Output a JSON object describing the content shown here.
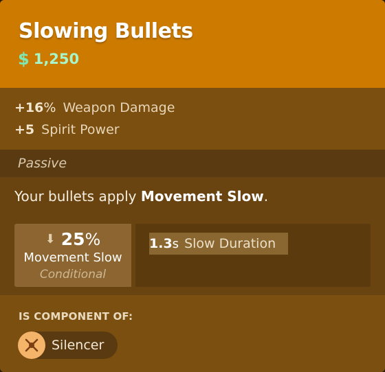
{
  "item": {
    "title": "Slowing Bullets",
    "cost": "1,250",
    "cost_icon": "souls-icon"
  },
  "stats": [
    {
      "value": "+16",
      "unit": "%",
      "label": "Weapon Damage"
    },
    {
      "value": "+5",
      "unit": "",
      "label": "Spirit Power"
    }
  ],
  "passive": {
    "header": "Passive",
    "description_prefix": "Your bullets apply ",
    "description_bold": "Movement Slow",
    "description_suffix": ".",
    "primary": {
      "value": "25",
      "unit": "%",
      "label": "Movement Slow",
      "condition": "Conditional",
      "icon": "slow-boot-icon"
    },
    "secondary": {
      "value": "1.3",
      "unit": "s",
      "label": "Slow Duration"
    }
  },
  "components": {
    "title": "IS COMPONENT OF:",
    "items": [
      {
        "name": "Silencer",
        "icon": "silencer-icon"
      }
    ]
  },
  "colors": {
    "header_bg": "#cc7a00",
    "cost_text": "#a7f5c9",
    "body_bg": "#6a4410",
    "component_icon_bg": "#f4b46a"
  }
}
